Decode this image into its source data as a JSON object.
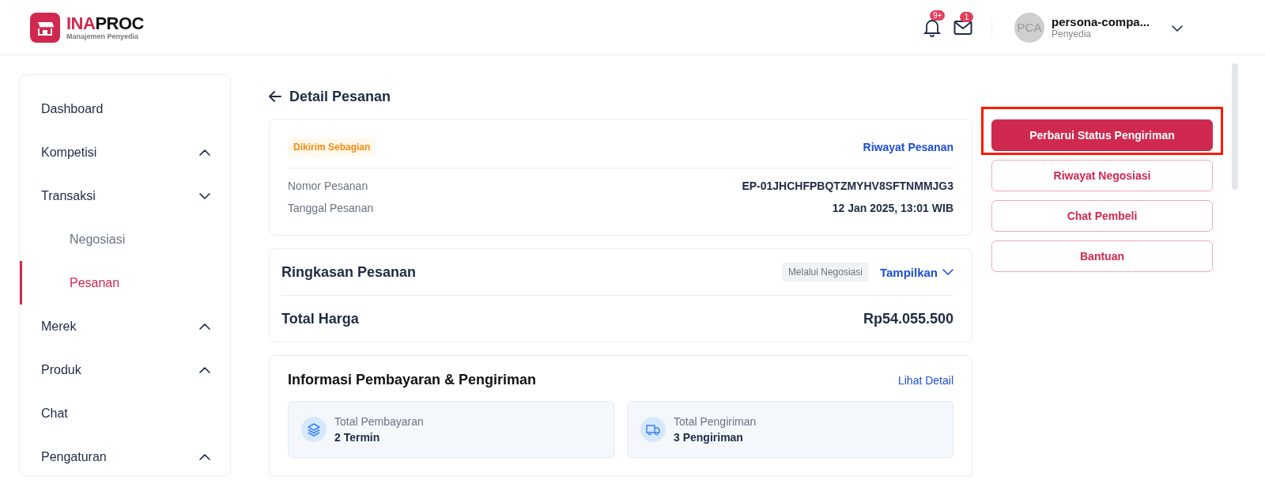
{
  "header": {
    "logo": {
      "brand_red": "INA",
      "brand_dark": "PROC",
      "subtitle": "Manajemen Penyedia"
    },
    "notifications": {
      "badge": "9+"
    },
    "messages": {
      "badge": "1"
    },
    "user": {
      "initials": "PCA",
      "name": "persona-compa...",
      "role": "Penyedia"
    }
  },
  "sidebar": {
    "items": [
      {
        "label": "Dashboard",
        "kind": "link",
        "selected": false
      },
      {
        "label": "Kompetisi",
        "kind": "group",
        "expanded": false,
        "selected": false
      },
      {
        "label": "Transaksi",
        "kind": "group",
        "expanded": true,
        "selected": false,
        "children": [
          {
            "label": "Negosiasi",
            "selected": false
          },
          {
            "label": "Pesanan",
            "selected": true
          }
        ]
      },
      {
        "label": "Merek",
        "kind": "group",
        "expanded": false,
        "selected": false
      },
      {
        "label": "Produk",
        "kind": "group",
        "expanded": false,
        "selected": false
      },
      {
        "label": "Chat",
        "kind": "link",
        "selected": false
      },
      {
        "label": "Pengaturan",
        "kind": "group",
        "expanded": false,
        "selected": false
      }
    ]
  },
  "page": {
    "title": "Detail Pesanan"
  },
  "order": {
    "status_badge": "Dikirim Sebagian",
    "history_link": "Riwayat Pesanan",
    "fields": [
      {
        "label": "Nomor Pesanan",
        "value": "EP-01JHCHFPBQTZMYHV8SFTNMMJG3"
      },
      {
        "label": "Tanggal Pesanan",
        "value": "12 Jan 2025, 13:01 WIB"
      }
    ]
  },
  "summary": {
    "title": "Ringkasan Pesanan",
    "tag": "Melalui Negosiasi",
    "toggle": "Tampilkan",
    "expanded": false,
    "total_label": "Total Harga",
    "total_value": "Rp54.055.500"
  },
  "payment_shipping": {
    "title": "Informasi Pembayaran & Pengiriman",
    "link": "Lihat Detail",
    "tiles": [
      {
        "kind": "payment",
        "label": "Total Pembayaran",
        "value": "2 Termin"
      },
      {
        "kind": "shipping",
        "label": "Total Pengiriman",
        "value": "3 Pengiriman"
      }
    ]
  },
  "actions": [
    {
      "label": "Perbarui Status Pengiriman",
      "kind": "primary",
      "highlighted": true
    },
    {
      "label": "Riwayat Negosiasi",
      "kind": "outline",
      "highlighted": false
    },
    {
      "label": "Chat Pembeli",
      "kind": "outline",
      "highlighted": false
    },
    {
      "label": "Bantuan",
      "kind": "outline",
      "highlighted": false
    }
  ]
}
